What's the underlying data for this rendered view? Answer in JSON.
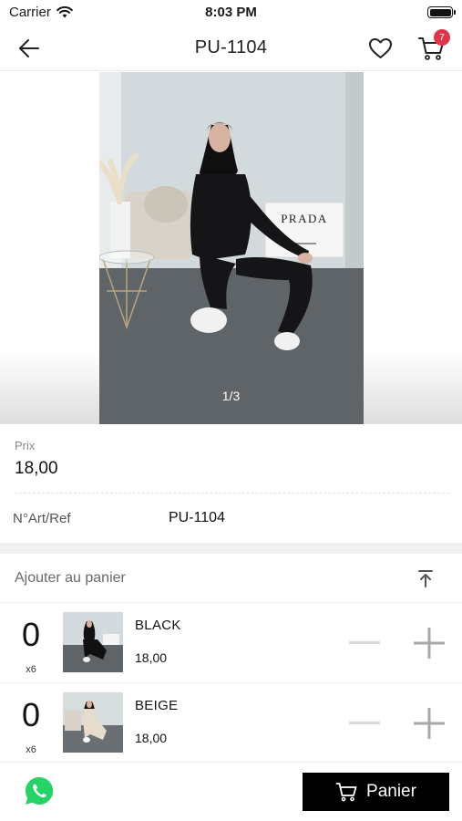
{
  "status_bar": {
    "carrier": "Carrier",
    "time": "8:03 PM"
  },
  "header": {
    "title": "PU-1104",
    "cart_count": "7"
  },
  "gallery": {
    "counter": "1/3",
    "sign_text": "PRADA"
  },
  "product": {
    "price_label": "Prix",
    "price_value": "18,00",
    "ref_label": "N°Art/Ref",
    "ref_value": "PU-1104"
  },
  "add_section": {
    "title": "Ajouter au panier"
  },
  "variants": [
    {
      "qty": "0",
      "multiplier": "x6",
      "name": "BLACK",
      "price": "18,00"
    },
    {
      "qty": "0",
      "multiplier": "x6",
      "name": "BEIGE",
      "price": "18,00"
    }
  ],
  "bottom_bar": {
    "panier_label": "Panier"
  },
  "icons": {
    "back": "arrow-left-icon",
    "favorite": "heart-icon",
    "cart": "cart-icon",
    "scroll_top": "arrow-up-to-line-icon",
    "minus": "minus-icon",
    "plus": "plus-icon",
    "whatsapp": "whatsapp-icon"
  },
  "colors": {
    "badge": "#e0334c",
    "panier_button": "#000000",
    "whatsapp": "#25d366"
  }
}
